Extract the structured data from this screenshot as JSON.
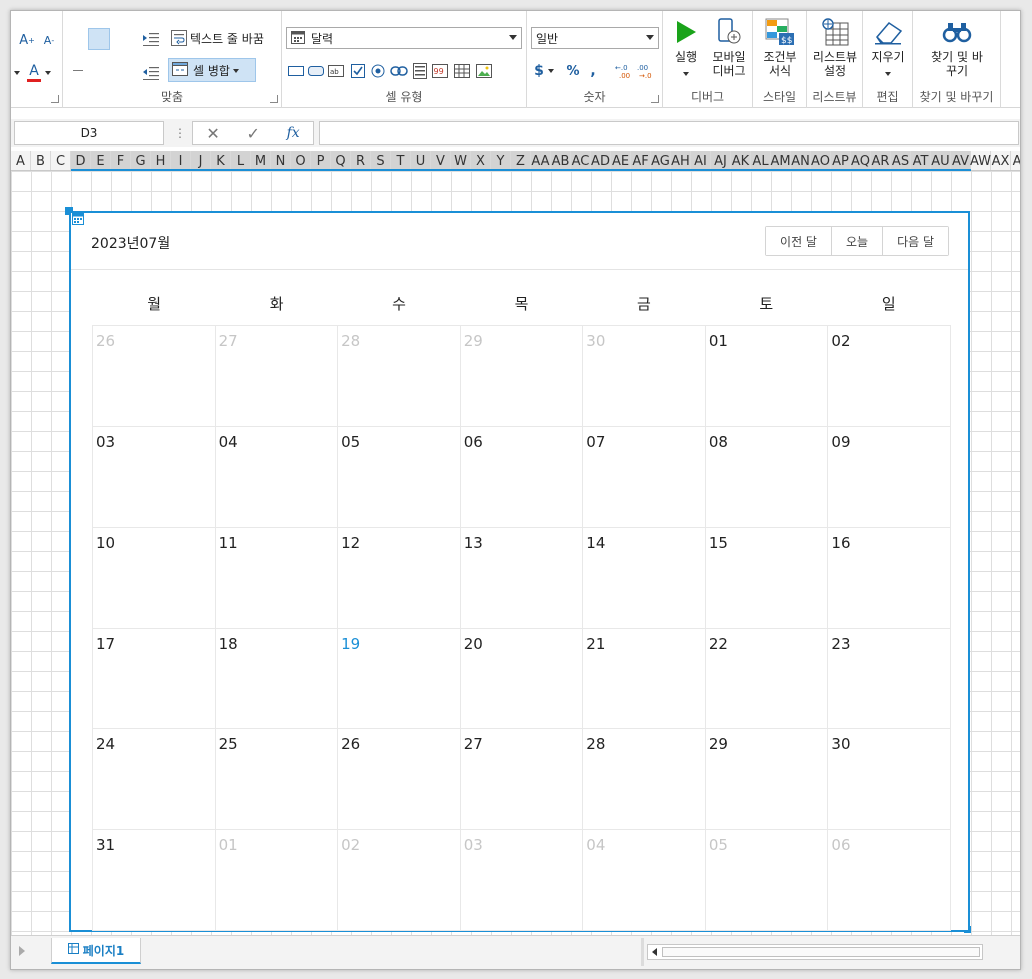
{
  "ribbon": {
    "align_group": {
      "label": "맞춤",
      "wrap_text_label": "텍스트 줄 바꿈",
      "merge_cells_label": "셀 병합"
    },
    "celltype_group": {
      "label": "셀 유형",
      "selected_type": "달력"
    },
    "number_group": {
      "label": "숫자",
      "format": "일반"
    },
    "debug_group": {
      "label": "디버그",
      "run_label": "실행",
      "mobile_debug_label": "모바일 디버그"
    },
    "style_group": {
      "label": "스타일",
      "conditional_format_label": "조건부 서식"
    },
    "listview_group": {
      "label": "리스트뷰",
      "listview_settings_label": "리스트뷰 설정"
    },
    "edit_group": {
      "label": "편집",
      "clear_label": "지우기"
    },
    "find_group": {
      "label": "찾기 및 바꾸기",
      "find_replace_label": "찾기 및 바꾸기"
    }
  },
  "formula_bar": {
    "name_box": "D3",
    "fx_label": "fx",
    "formula": ""
  },
  "columns": [
    "A",
    "B",
    "C",
    "D",
    "E",
    "F",
    "G",
    "H",
    "I",
    "J",
    "K",
    "L",
    "M",
    "N",
    "O",
    "P",
    "Q",
    "R",
    "S",
    "T",
    "U",
    "V",
    "W",
    "X",
    "Y",
    "Z",
    "AA",
    "AB",
    "AC",
    "AD",
    "AE",
    "AF",
    "AG",
    "AH",
    "AI",
    "AJ",
    "AK",
    "AL",
    "AM",
    "AN",
    "AO",
    "AP",
    "AQ",
    "AR",
    "AS",
    "AT",
    "AU",
    "AV",
    "AW",
    "AX",
    "AY"
  ],
  "calendar": {
    "title": "2023년07월",
    "nav": {
      "prev": "이전 달",
      "today": "오늘",
      "next": "다음 달"
    },
    "weekdays": [
      "월",
      "화",
      "수",
      "목",
      "금",
      "토",
      "일"
    ],
    "days": [
      {
        "label": "26",
        "state": "other"
      },
      {
        "label": "27",
        "state": "other"
      },
      {
        "label": "28",
        "state": "other"
      },
      {
        "label": "29",
        "state": "other"
      },
      {
        "label": "30",
        "state": "other"
      },
      {
        "label": "01",
        "state": "current"
      },
      {
        "label": "02",
        "state": "current"
      },
      {
        "label": "03",
        "state": "current"
      },
      {
        "label": "04",
        "state": "current"
      },
      {
        "label": "05",
        "state": "current"
      },
      {
        "label": "06",
        "state": "current"
      },
      {
        "label": "07",
        "state": "current"
      },
      {
        "label": "08",
        "state": "current"
      },
      {
        "label": "09",
        "state": "current"
      },
      {
        "label": "10",
        "state": "current"
      },
      {
        "label": "11",
        "state": "current"
      },
      {
        "label": "12",
        "state": "current"
      },
      {
        "label": "13",
        "state": "current"
      },
      {
        "label": "14",
        "state": "current"
      },
      {
        "label": "15",
        "state": "current"
      },
      {
        "label": "16",
        "state": "current"
      },
      {
        "label": "17",
        "state": "current"
      },
      {
        "label": "18",
        "state": "current"
      },
      {
        "label": "19",
        "state": "today"
      },
      {
        "label": "20",
        "state": "current"
      },
      {
        "label": "21",
        "state": "current"
      },
      {
        "label": "22",
        "state": "current"
      },
      {
        "label": "23",
        "state": "current"
      },
      {
        "label": "24",
        "state": "current"
      },
      {
        "label": "25",
        "state": "current"
      },
      {
        "label": "26",
        "state": "current"
      },
      {
        "label": "27",
        "state": "current"
      },
      {
        "label": "28",
        "state": "current"
      },
      {
        "label": "29",
        "state": "current"
      },
      {
        "label": "30",
        "state": "current"
      },
      {
        "label": "31",
        "state": "current"
      },
      {
        "label": "01",
        "state": "other"
      },
      {
        "label": "02",
        "state": "other"
      },
      {
        "label": "03",
        "state": "other"
      },
      {
        "label": "04",
        "state": "other"
      },
      {
        "label": "05",
        "state": "other"
      },
      {
        "label": "06",
        "state": "other"
      }
    ]
  },
  "sheet_tabs": [
    {
      "label": "페이지1",
      "active": true
    }
  ],
  "colors": {
    "accent": "#1a8fd6",
    "today_text": "#1a8fd6",
    "other_month_text": "#c6c6c6",
    "run_icon": "#1aa31a"
  }
}
